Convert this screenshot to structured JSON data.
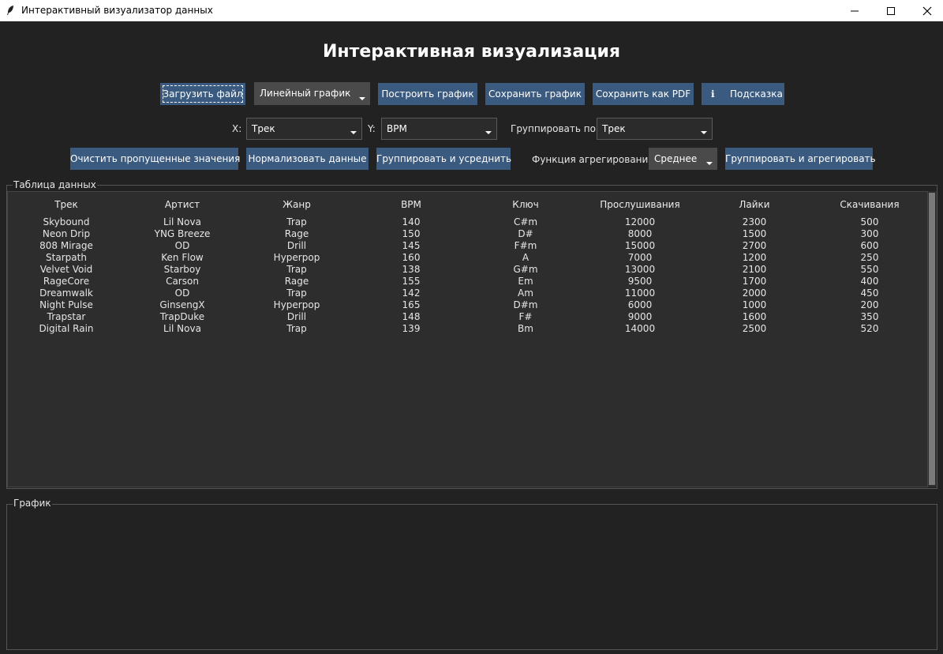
{
  "window": {
    "title": "Интерактивный визуализатор данных",
    "icon": "feather-icon"
  },
  "header": {
    "title": "Интерактивная визуализация"
  },
  "toolbar": {
    "load_file": "Загрузить файл",
    "chart_type": "Линейный график",
    "build_chart": "Построить график",
    "save_chart": "Сохранить график",
    "save_pdf": "Сохранить как PDF",
    "hint_icon": "ℹ",
    "hint": "Подсказка"
  },
  "axes": {
    "x_label": "X:",
    "x_value": "Трек",
    "y_label": "Y:",
    "y_value": "BPM",
    "group_label": "Группировать по:",
    "group_value": "Трек"
  },
  "actions": {
    "clean_missing": "Очистить пропущенные значения",
    "normalize": "Нормализовать данные",
    "group_average": "Группировать и усреднить",
    "agg_label": "Функция агрегирования:",
    "agg_value": "Среднее",
    "group_aggregate": "Группировать и агрегировать"
  },
  "table": {
    "frame_title": "Таблица данных",
    "columns": [
      "Трек",
      "Артист",
      "Жанр",
      "BPM",
      "Ключ",
      "Прослушивания",
      "Лайки",
      "Скачивания"
    ],
    "rows": [
      [
        "Skybound",
        "Lil Nova",
        "Trap",
        "140",
        "C#m",
        "12000",
        "2300",
        "500"
      ],
      [
        "Neon Drip",
        "YNG Breeze",
        "Rage",
        "150",
        "D#",
        "8000",
        "1500",
        "300"
      ],
      [
        "808 Mirage",
        "OD",
        "Drill",
        "145",
        "F#m",
        "15000",
        "2700",
        "600"
      ],
      [
        "Starpath",
        "Ken Flow",
        "Hyperpop",
        "160",
        "A",
        "7000",
        "1200",
        "250"
      ],
      [
        "Velvet Void",
        "Starboy",
        "Trap",
        "138",
        "G#m",
        "13000",
        "2100",
        "550"
      ],
      [
        "RageCore",
        "Carson",
        "Rage",
        "155",
        "Em",
        "9500",
        "1700",
        "400"
      ],
      [
        "Dreamwalk",
        "OD",
        "Trap",
        "142",
        "Am",
        "11000",
        "2000",
        "450"
      ],
      [
        "Night Pulse",
        "GinsengX",
        "Hyperpop",
        "165",
        "D#m",
        "6000",
        "1000",
        "200"
      ],
      [
        "Trapstar",
        "TrapDuke",
        "Drill",
        "148",
        "F#",
        "9000",
        "1600",
        "350"
      ],
      [
        "Digital Rain",
        "Lil Nova",
        "Trap",
        "139",
        "Bm",
        "14000",
        "2500",
        "520"
      ]
    ]
  },
  "chart_panel": {
    "frame_title": "График"
  }
}
